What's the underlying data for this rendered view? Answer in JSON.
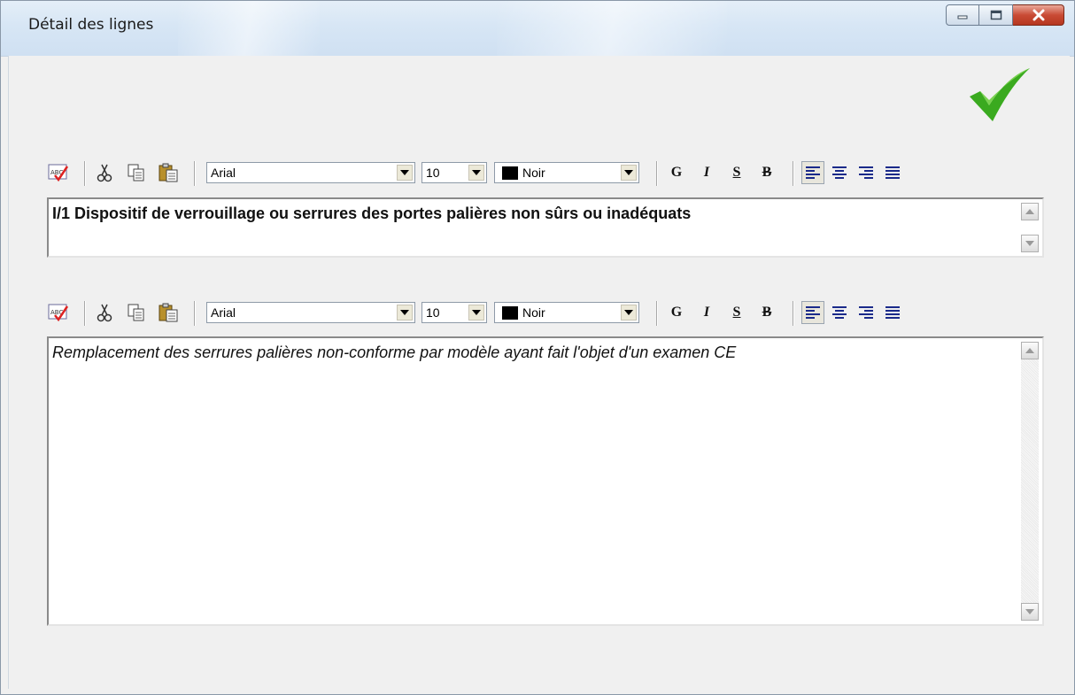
{
  "window": {
    "title": "Détail des lignes",
    "controls": [
      "minimize",
      "maximize",
      "close"
    ]
  },
  "actions": {
    "validate_icon": "green-checkmark"
  },
  "toolbars": [
    {
      "font": "Arial",
      "size": "10",
      "color_label": "Noir",
      "color_value": "#000000",
      "format_buttons": [
        "G",
        "I",
        "S",
        "B"
      ]
    },
    {
      "font": "Arial",
      "size": "10",
      "color_label": "Noir",
      "color_value": "#000000",
      "format_buttons": [
        "G",
        "I",
        "S",
        "B"
      ]
    }
  ],
  "editors": {
    "title_text": "I/1 Dispositif de verrouillage ou serrures des portes palières non sûrs ou inadéquats",
    "description_text": "Remplacement des serrures palières non-conforme par modèle ayant fait l'objet d'un examen CE"
  },
  "colors": {
    "accent_check": "#3aaa1f",
    "close_button": "#c94b35"
  }
}
